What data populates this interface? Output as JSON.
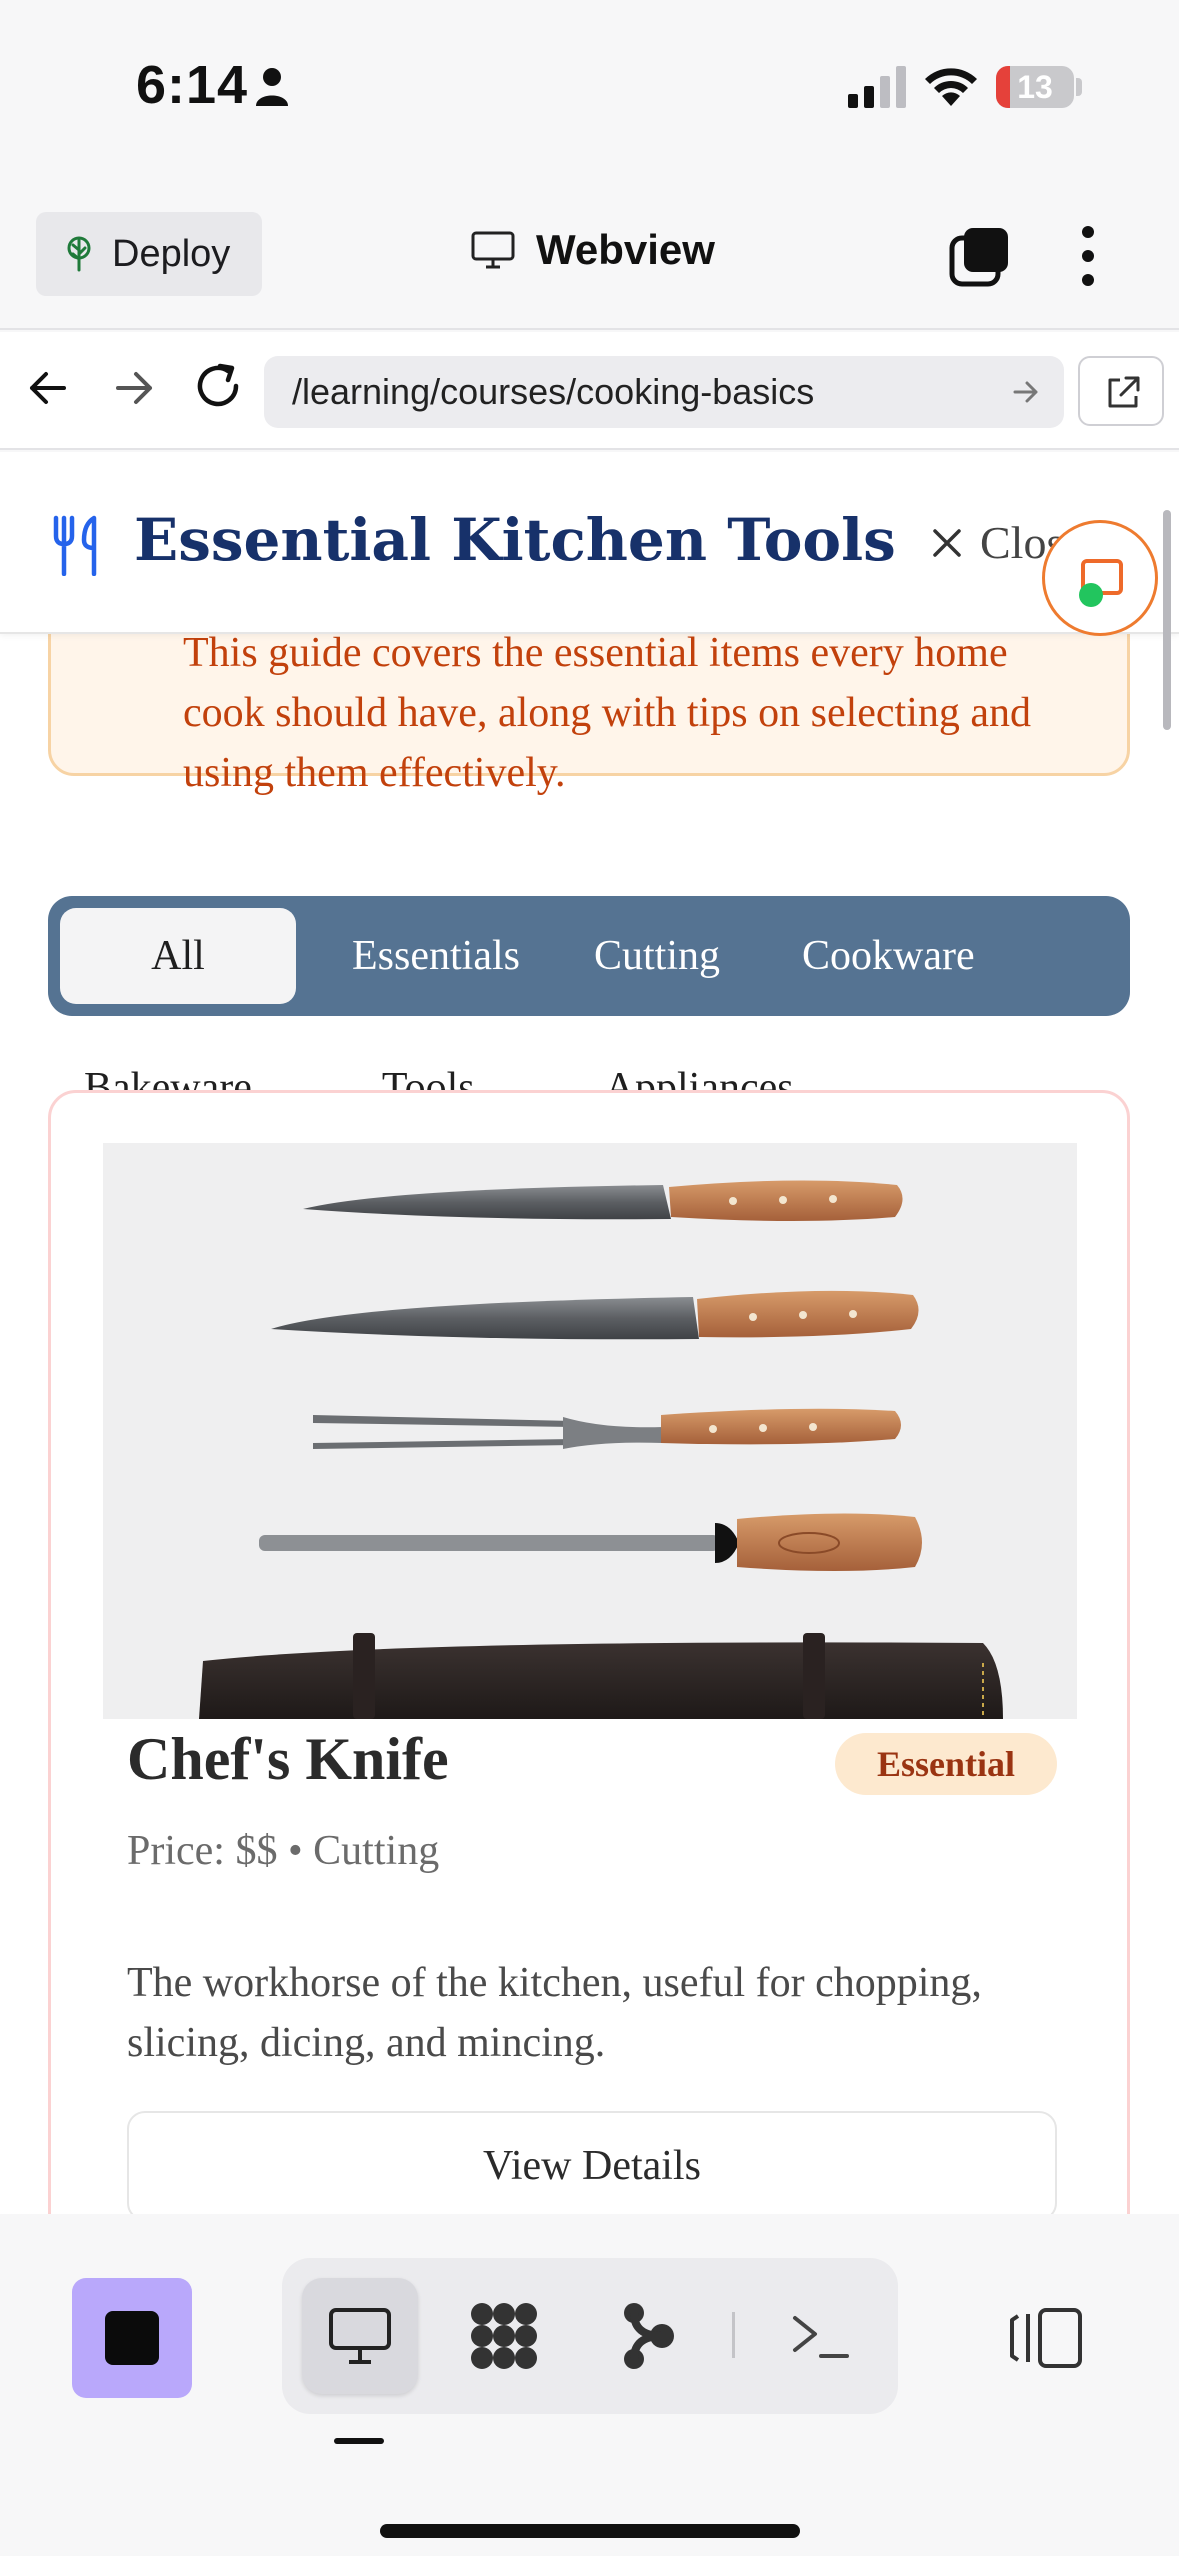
{
  "status_bar": {
    "time": "6:14",
    "battery": "13"
  },
  "app_header": {
    "deploy_label": "Deploy",
    "title": "Webview"
  },
  "browser": {
    "url": "/learning/courses/cooking-basics"
  },
  "page": {
    "title": "Essential Kitchen Tools",
    "close_label": "Close",
    "notice_text": "This guide covers the essential items every home cook should have, along with tips on selecting and using them effectively.",
    "filters_row1": [
      "All",
      "Essentials",
      "Cutting",
      "Cookware"
    ],
    "filters_row2": [
      "Bakeware",
      "Tools",
      "Appliances"
    ],
    "active_filter": "All"
  },
  "card": {
    "name": "Chef's Knife",
    "badge": "Essential",
    "meta": "Price: $$ • Cutting",
    "description": "The workhorse of the kitchen, useful for chopping, slicing, dicing, and mincing.",
    "button_label": "View Details"
  },
  "colors": {
    "title_navy": "#17316a",
    "notice_text": "#c2410c",
    "filter_bar": "#557392",
    "badge_bg": "#fde9cf",
    "stop_button": "#b9a8fb"
  },
  "icons": {
    "deploy": "tree-icon",
    "webview": "monitor-icon",
    "page_logo": "utensils-icon",
    "toolbar": [
      "monitor-icon",
      "grid-blob-icon",
      "branch-icon",
      "terminal-icon",
      "panel-toggle-icon"
    ]
  }
}
